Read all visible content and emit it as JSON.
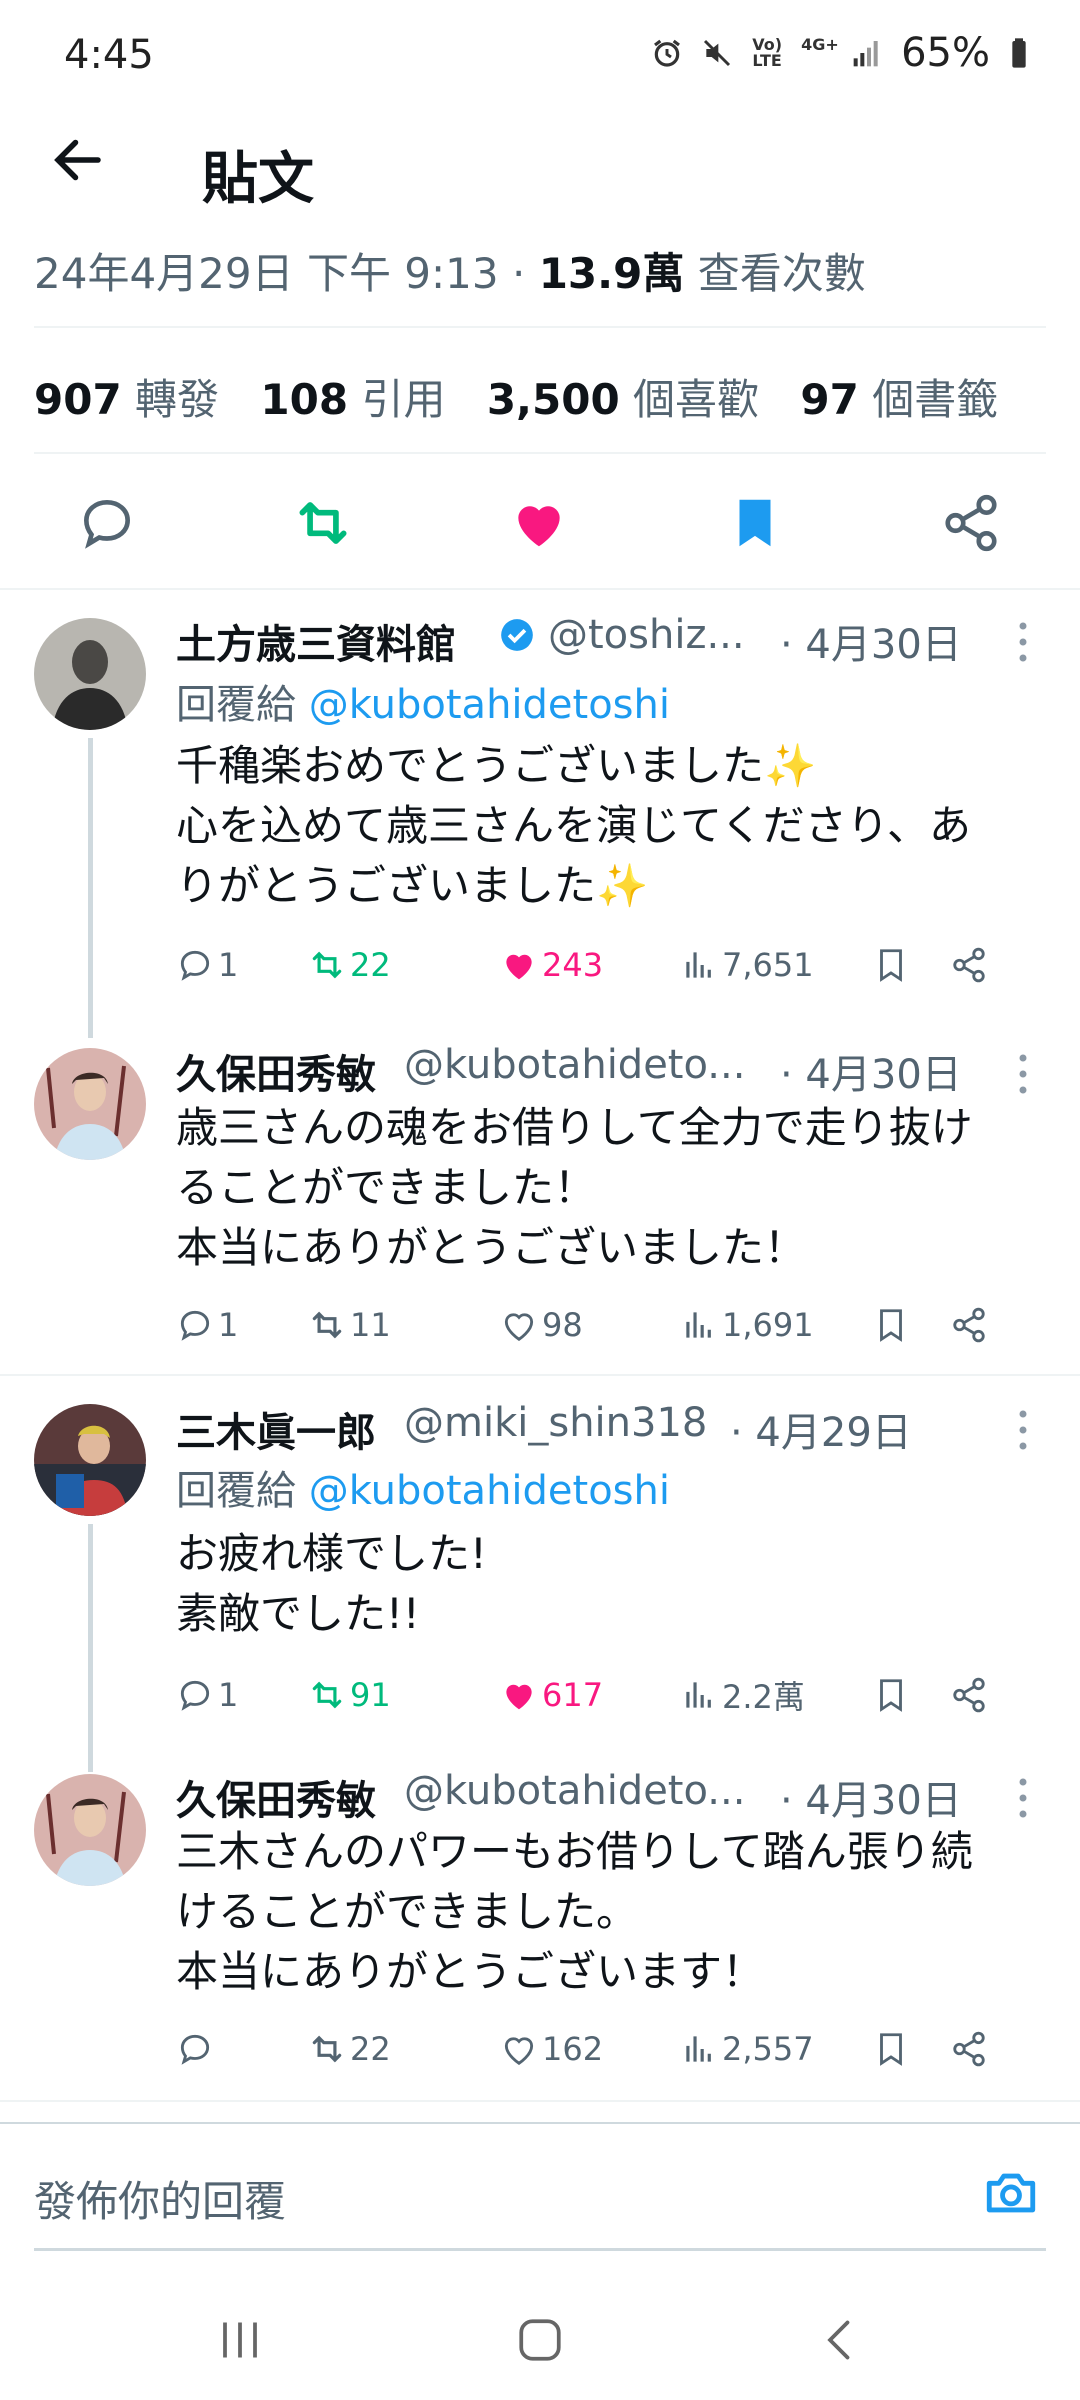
{
  "status_bar": {
    "time": "4:45",
    "battery": "65%",
    "volte": "Vo) LTE",
    "net": "4G+"
  },
  "header": {
    "title": "貼文"
  },
  "post_meta": {
    "date": "24年4月29日 下午 9:13 · ",
    "views": "13.9萬",
    "views_label": "查看次數"
  },
  "stats": [
    {
      "value": "907",
      "label": "轉發"
    },
    {
      "value": "108",
      "label": "引用"
    },
    {
      "value": "3,500",
      "label": "個喜歡"
    },
    {
      "value": "97",
      "label": "個書籤"
    }
  ],
  "replies": [
    {
      "name": "土方歳三資料館",
      "handle": "@toshiz...",
      "date": "· 4月30日",
      "replying_prefix": "回覆給",
      "replying_to": "@kubotahidetoshi",
      "lines": [
        "千穐楽おめでとうございました✨",
        "心を込めて歳三さんを演じてくださり、あ",
        "りがとうございました✨"
      ],
      "reply_count": "1",
      "retweets": "22",
      "likes": "243",
      "views": "7,651"
    },
    {
      "name": "久保田秀敏",
      "handle": "@kubotahideto...",
      "date": "· 4月30日",
      "lines": [
        "歳三さんの魂をお借りして全力で走り抜け",
        "ることができました！",
        "本当にありがとうございました！"
      ],
      "reply_count": "1",
      "retweets": "11",
      "likes": "98",
      "views": "1,691"
    },
    {
      "name": "三木眞一郎",
      "handle": "@miki_shin318",
      "date": "· 4月29日",
      "replying_prefix": "回覆給",
      "replying_to": "@kubotahidetoshi",
      "lines": [
        "お疲れ様でした!",
        "素敵でした!!"
      ],
      "reply_count": "1",
      "retweets": "91",
      "likes": "617",
      "views": "2.2萬"
    },
    {
      "name": "久保田秀敏",
      "handle": "@kubotahideto...",
      "date": "· 4月30日",
      "lines": [
        "三木さんのパワーもお借りして踏ん張り続",
        "けることができました。",
        "本当にありがとうございます！"
      ],
      "reply_count": "",
      "retweets": "22",
      "likes": "162",
      "views": "2,557"
    }
  ],
  "compose": {
    "placeholder": "發佈你的回覆"
  },
  "colors": {
    "accent": "#1d9bf0",
    "retweet": "#00ba7c",
    "like": "#f91880",
    "muted": "#536471"
  }
}
